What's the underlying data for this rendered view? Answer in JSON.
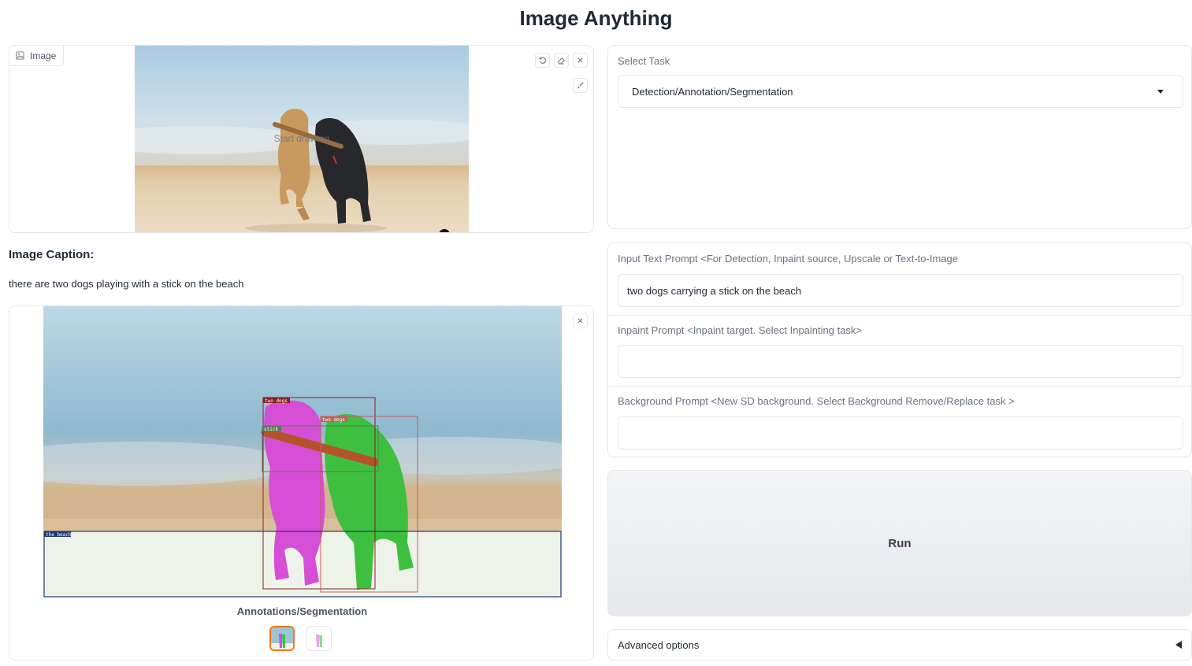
{
  "app": {
    "title": "Image Anything"
  },
  "input_image": {
    "tag_label": "Image",
    "overlay_text": "Start drawing"
  },
  "caption": {
    "title": "Image Caption:",
    "text": "there are two dogs playing with a stick on the beach"
  },
  "output_gallery": {
    "caption": "Annotations/Segmentation",
    "box_labels": [
      "two dogs",
      "two dogs",
      "stick",
      "the beach"
    ]
  },
  "task": {
    "label": "Select Task",
    "selected": "Detection/Annotation/Segmentation"
  },
  "prompts": {
    "input_label": "Input Text Prompt <For Detection, Inpaint source, Upscale or Text-to-Image",
    "input_value": "two dogs carrying a stick on the beach",
    "inpaint_label": "Inpaint Prompt <Inpaint target. Select Inpainting task>",
    "inpaint_value": "",
    "background_label": "Background Prompt <New SD background. Select Background Remove/Replace task >",
    "background_value": ""
  },
  "run": {
    "label": "Run"
  },
  "advanced": {
    "label": "Advanced options"
  },
  "colors": {
    "accent": "#f97316",
    "mask_dog1": "#d946ef",
    "mask_dog2": "#22c55e",
    "stick": "#b45309"
  }
}
